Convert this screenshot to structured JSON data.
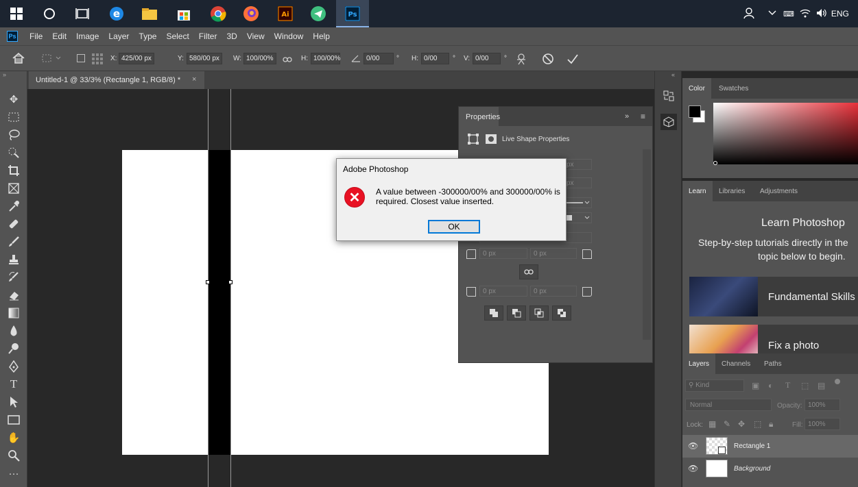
{
  "taskbar": {
    "apps": [
      "windows-start",
      "cortana",
      "task-view",
      "edge",
      "file-explorer",
      "store",
      "chrome",
      "firefox",
      "illustrator",
      "telegram",
      "photoshop"
    ],
    "tray_lang": "ENG"
  },
  "menu": {
    "logo": "Ps",
    "items": [
      "File",
      "Edit",
      "Image",
      "Layer",
      "Type",
      "Select",
      "Filter",
      "3D",
      "View",
      "Window",
      "Help"
    ]
  },
  "options": {
    "x_label": "X:",
    "x_value": "425/00 px",
    "y_label": "Y:",
    "y_value": "580/00 px",
    "w_label": "W:",
    "w_value": "100/00%",
    "h_label": "H:",
    "h_value": "100/00%",
    "angle_value": "0/00",
    "deg": "°",
    "hskew_label": "H:",
    "hskew_value": "0/00",
    "vskew_label": "V:",
    "vskew_value": "0/00"
  },
  "document": {
    "tab_title": "Untitled-1 @ 33/3% (Rectangle 1, RGB/8) *",
    "close": "×"
  },
  "properties": {
    "tab": "Properties",
    "live_shape": "Live Shape Properties",
    "px_placeholder": "0 px",
    "px_short": "px"
  },
  "color_panel": {
    "tabs": [
      "Color",
      "Swatches"
    ],
    "accent": "#e8313a"
  },
  "learn_panel": {
    "tabs": [
      "Learn",
      "Libraries",
      "Adjustments"
    ],
    "title": "Learn Photoshop",
    "subtitle_line1": "Step-by-step tutorials directly in the",
    "subtitle_line2": "topic below to begin.",
    "cards": [
      "Fundamental Skills",
      "Fix a photo"
    ]
  },
  "layers_panel": {
    "tabs": [
      "Layers",
      "Channels",
      "Paths"
    ],
    "kind": "Kind",
    "blend": "Normal",
    "opacity_label": "Opacity:",
    "opacity_value": "100%",
    "lock_label": "Lock:",
    "fill_label": "Fill:",
    "fill_value": "100%",
    "layers": [
      "Rectangle 1",
      "Background"
    ]
  },
  "dialog": {
    "title": "Adobe Photoshop",
    "message": "A value between -300000/00% and 300000/00% is required.  Closest value inserted.",
    "ok": "OK"
  }
}
